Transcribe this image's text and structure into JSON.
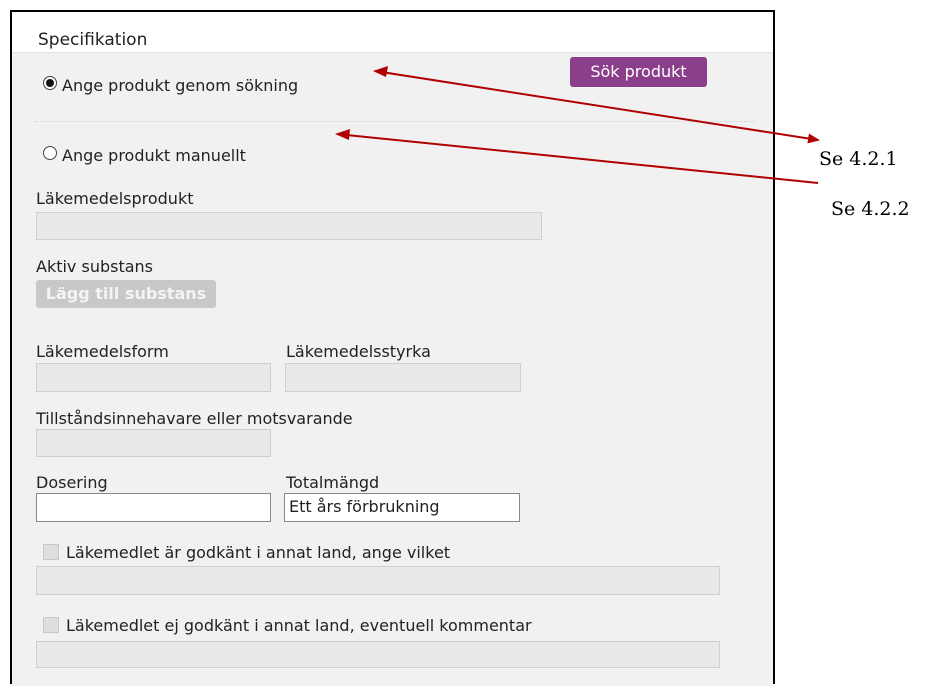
{
  "panel": {
    "title": "Specifikation"
  },
  "radios": [
    {
      "label": "Ange produkt genom sökning",
      "checked": true
    },
    {
      "label": "Ange produkt manuellt",
      "checked": false
    }
  ],
  "search_button_label": "Sök produkt",
  "fields": {
    "lakemedelsprodukt": {
      "label": "Läkemedelsprodukt",
      "value": ""
    },
    "aktiv_substans": {
      "label": "Aktiv substans",
      "button_label": "Lägg till substans"
    },
    "lakemedelsform": {
      "label": "Läkemedelsform",
      "value": ""
    },
    "lakemedelsstyrka": {
      "label": "Läkemedelsstyrka",
      "value": ""
    },
    "tillstand": {
      "label": "Tillståndsinnehavare eller motsvarande",
      "value": ""
    },
    "dosering": {
      "label": "Dosering",
      "value": ""
    },
    "totalmangd": {
      "label": "Totalmängd",
      "value": "Ett års förbrukning"
    }
  },
  "checkboxes": [
    {
      "label": "Läkemedlet är godkänt i annat land, ange vilket",
      "checked": false
    },
    {
      "label": "Läkemedlet ej godkänt i annat land, eventuell kommentar",
      "checked": false
    }
  ],
  "annotations": [
    {
      "text": "Se 4.2.1"
    },
    {
      "text": "Se 4.2.2"
    }
  ],
  "colors": {
    "arrow": "#b00000",
    "button_purple": "#8b3f8b",
    "panel_bg": "#f1f1f1"
  }
}
